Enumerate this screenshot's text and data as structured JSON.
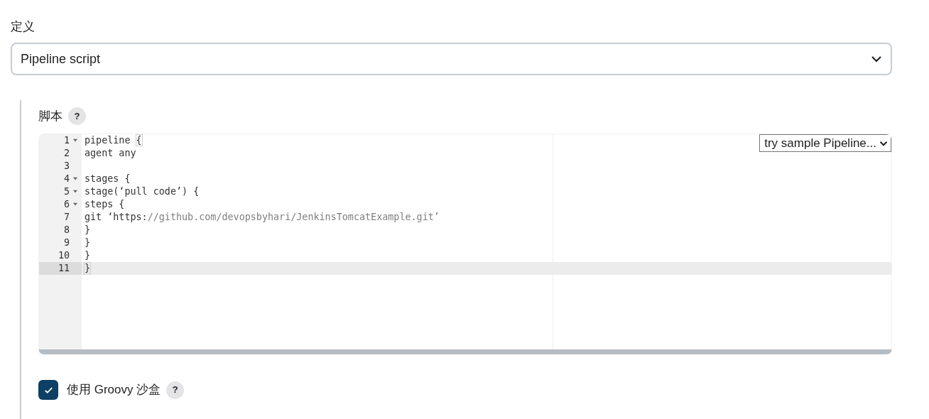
{
  "definition": {
    "label": "定义",
    "select": {
      "value": "Pipeline script"
    }
  },
  "script": {
    "label": "脚本",
    "help": "?",
    "sample_select": {
      "value": "try sample Pipeline..."
    },
    "editor": {
      "lines": [
        {
          "number": "1",
          "foldable": true,
          "active": false,
          "segments": [
            {
              "kind": "code",
              "text": "pipeline "
            },
            {
              "kind": "bracket",
              "text": "{"
            }
          ]
        },
        {
          "number": "2",
          "foldable": false,
          "active": false,
          "segments": [
            {
              "kind": "code",
              "text": "agent any"
            }
          ]
        },
        {
          "number": "3",
          "foldable": false,
          "active": false
        },
        {
          "number": "4",
          "foldable": true,
          "active": false,
          "segments": [
            {
              "kind": "code",
              "text": "stages {"
            }
          ]
        },
        {
          "number": "5",
          "foldable": true,
          "active": false,
          "segments": [
            {
              "kind": "code",
              "text": "stage(‘pull code’) {"
            }
          ]
        },
        {
          "number": "6",
          "foldable": true,
          "active": false,
          "segments": [
            {
              "kind": "code",
              "text": "steps {"
            }
          ]
        },
        {
          "number": "7",
          "foldable": false,
          "active": false,
          "segments": [
            {
              "kind": "code",
              "text": "git ‘https:"
            },
            {
              "kind": "comment",
              "text": "//github.com/devopsbyhari/JenkinsTomcatExample.git’"
            }
          ]
        },
        {
          "number": "8",
          "foldable": false,
          "active": false,
          "segments": [
            {
              "kind": "code",
              "text": "}"
            }
          ]
        },
        {
          "number": "9",
          "foldable": false,
          "active": false,
          "segments": [
            {
              "kind": "code",
              "text": "}"
            }
          ]
        },
        {
          "number": "10",
          "foldable": false,
          "active": false,
          "segments": [
            {
              "kind": "code",
              "text": "}"
            }
          ]
        },
        {
          "number": "11",
          "foldable": false,
          "active": true,
          "segments": [
            {
              "kind": "bracket",
              "text": "}"
            }
          ]
        }
      ]
    }
  },
  "sandbox": {
    "label": "使用 Groovy 沙盒",
    "checked": true,
    "help": "?"
  }
}
